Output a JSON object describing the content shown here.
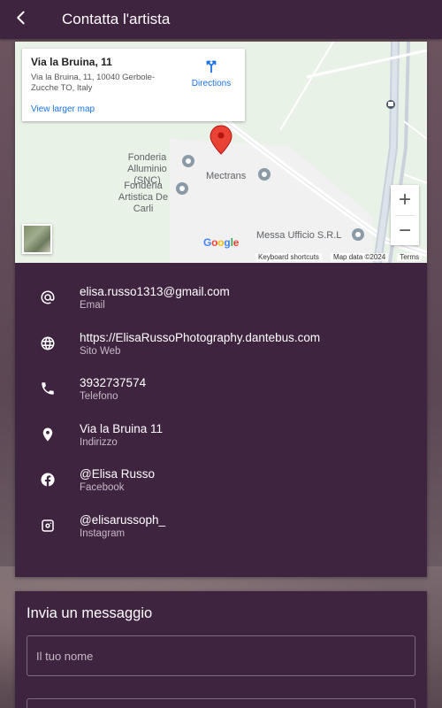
{
  "header": {
    "title": "Contatta l'artista",
    "back_icon": "arrow-back-icon"
  },
  "map": {
    "place_title": "Via la Bruina, 11",
    "place_address": "Via la Bruina, 11, 10040 Gerbole-Zucche TO, Italy",
    "view_larger": "View larger map",
    "directions": "Directions",
    "pois": [
      {
        "name": "Fonderia Alluminio (SNC)"
      },
      {
        "name": "Fonderia Artistica De Carli"
      },
      {
        "name": "Mectrans"
      },
      {
        "name": "Messa Ufficio S.R.L"
      }
    ],
    "google": "Google",
    "footer": [
      "Keyboard shortcuts",
      "Map data ©2024",
      "Terms"
    ],
    "zoom_in": "+",
    "zoom_out": "−"
  },
  "contacts": [
    {
      "icon": "at-icon",
      "value": "elisa.russo1313@gmail.com",
      "label": "Email"
    },
    {
      "icon": "globe-icon",
      "value": "https://ElisaRussoPhotography.dantebus.com",
      "label": "Sito Web"
    },
    {
      "icon": "phone-icon",
      "value": "3932737574",
      "label": "Telefono"
    },
    {
      "icon": "location-pin-icon",
      "value": "Via la Bruina 11",
      "label": "Indirizzo"
    },
    {
      "icon": "facebook-icon",
      "value": "@Elisa Russo",
      "label": "Facebook"
    },
    {
      "icon": "instagram-icon",
      "value": "@elisarussoph_",
      "label": "Instagram"
    }
  ],
  "message": {
    "title": "Invia un messaggio",
    "name_placeholder": "Il tuo nome"
  },
  "colors": {
    "primary": "#3f2440",
    "link": "#1a73e8",
    "marker": "#ea4335"
  }
}
